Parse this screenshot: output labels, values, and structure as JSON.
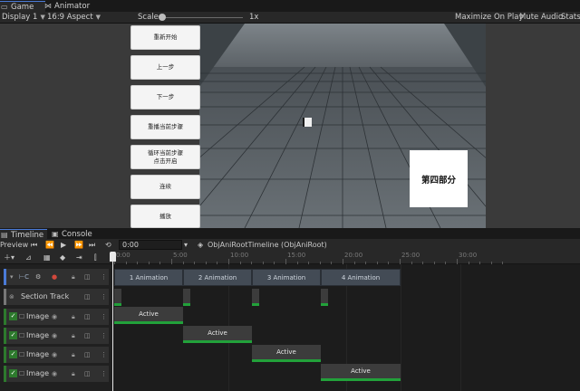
{
  "top_tabs": {
    "game": "Game",
    "animator": "Animator"
  },
  "game_toolbar": {
    "display": "Display 1",
    "aspect": "16:9 Aspect",
    "scale_label": "Scale",
    "scale_value": "1x",
    "maximize": "Maximize On Play",
    "mute": "Mute Audio",
    "stats": "Stats"
  },
  "game_buttons": [
    "重新开始",
    "上一步",
    "下一步",
    "重播当前步骤",
    "循环当前步骤\n点击开启",
    "连续",
    "播放"
  ],
  "section_label": "第四部分",
  "timeline_tabs": {
    "timeline": "Timeline",
    "console": "Console"
  },
  "timeline_toolbar": {
    "preview": "Preview",
    "time": "0:00",
    "asset": "ObjAniRootTimeline (ObjAniRoot)"
  },
  "ruler_labels": [
    "0:00",
    "5:00",
    "10:00",
    "15:00",
    "20:00",
    "25:00",
    "30:00"
  ],
  "tracks": [
    {
      "name": "",
      "kind": "control"
    },
    {
      "name": "Section Track",
      "kind": "section"
    },
    {
      "name": "Image",
      "kind": "image"
    },
    {
      "name": "Image",
      "kind": "image"
    },
    {
      "name": "Image",
      "kind": "image"
    },
    {
      "name": "Image",
      "kind": "image"
    }
  ],
  "animation_segments": [
    "1 Animation",
    "2 Animation",
    "3 Animation",
    "4 Animation"
  ],
  "clip_label": "Active",
  "colors": {
    "active_bar": "#22a13a",
    "accent": "#4a7bd8"
  }
}
